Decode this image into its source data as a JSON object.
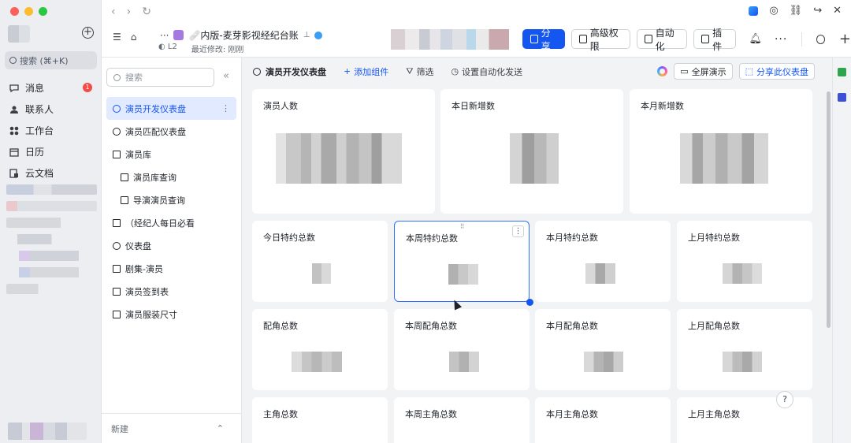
{
  "rail": {
    "search_label": "搜索 (⌘+K)",
    "items": [
      {
        "label": "消息",
        "badge": "1",
        "icon": "chat-bubble-icon"
      },
      {
        "label": "联系人",
        "icon": "contacts-icon"
      },
      {
        "label": "工作台",
        "icon": "grid-icon"
      },
      {
        "label": "日历",
        "icon": "calendar-icon"
      },
      {
        "label": "云文档",
        "icon": "cloud-doc-icon"
      }
    ]
  },
  "topbar": {
    "doc_title": "🩹内版-麦芽影视经纪台账",
    "level": "L2",
    "last_modified": "最近修改: 刚刚",
    "share": "分享",
    "advanced_permission": "高级权限",
    "automation": "自动化",
    "plugins": "插件"
  },
  "sidebar": {
    "search_placeholder": "搜索",
    "items": [
      {
        "label": "演员开发仪表盘",
        "icon": "dashboard-icon",
        "active": true
      },
      {
        "label": "演员匹配仪表盘",
        "icon": "dashboard-icon"
      },
      {
        "label": "演员库",
        "icon": "table-icon"
      },
      {
        "label": "演员库查询",
        "icon": "form-icon",
        "sub": true
      },
      {
        "label": "导演演员查询",
        "icon": "form-icon",
        "sub": true
      },
      {
        "label": "（经纪人每日必看",
        "icon": "table-icon"
      },
      {
        "label": "仪表盘",
        "icon": "dashboard-icon"
      },
      {
        "label": "剧集-演员",
        "icon": "table-icon"
      },
      {
        "label": "演员签到表",
        "icon": "table-icon"
      },
      {
        "label": "演员服装尺寸",
        "icon": "table-icon"
      }
    ],
    "new_label": "新建"
  },
  "dashboard": {
    "title": "演员开发仪表盘",
    "add_widget": "添加组件",
    "filter": "筛选",
    "auto_send": "设置自动化发送",
    "fullscreen": "全屏演示",
    "share_dashboard": "分享此仪表盘",
    "cards": [
      "演员人数",
      "本日新增数",
      "本月新增数",
      "今日特约总数",
      "本周特约总数",
      "本月特约总数",
      "上月特约总数",
      "配角总数",
      "本周配角总数",
      "本月配角总数",
      "上月配角总数",
      "主角总数",
      "本周主角总数",
      "本月主角总数",
      "上月主角总数"
    ]
  },
  "help_label": "?",
  "colors": {
    "accent": "#1456f0",
    "badge": "#f54a45",
    "active_bg": "#e1eaff"
  }
}
